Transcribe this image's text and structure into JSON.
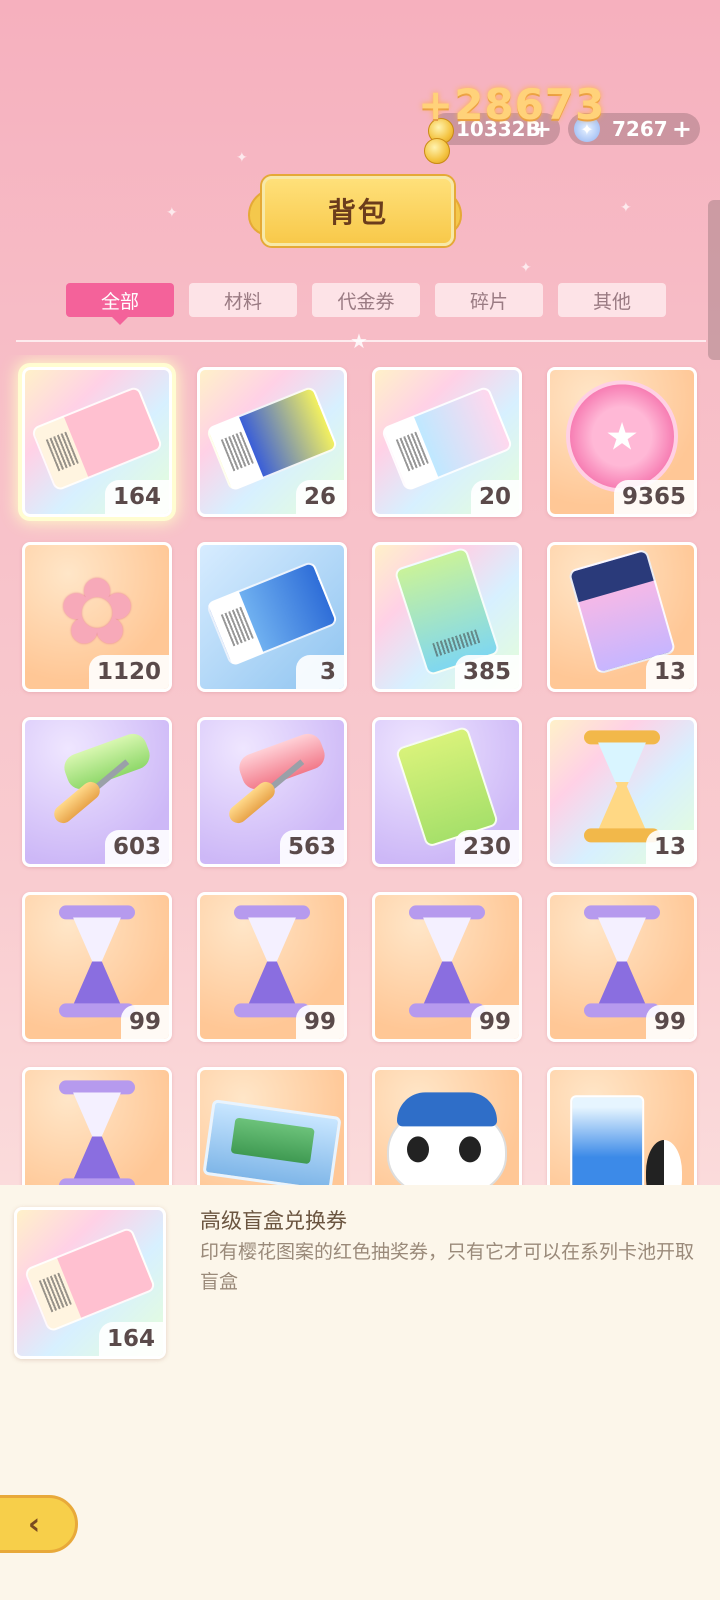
{
  "header": {
    "title": "背包",
    "gold_amount": "10332B",
    "gold_gain": "+28673",
    "gem_amount": "7267",
    "plus": "+"
  },
  "tabs": [
    {
      "label": "全部",
      "active": true
    },
    {
      "label": "材料",
      "active": false
    },
    {
      "label": "代金券",
      "active": false
    },
    {
      "label": "碎片",
      "active": false
    },
    {
      "label": "其他",
      "active": false
    }
  ],
  "items": [
    {
      "icon": "pink-sakura-ticket-icon",
      "qty": "164",
      "selected": true
    },
    {
      "icon": "mystery-ticket-icon",
      "qty": "26"
    },
    {
      "icon": "rainbow-character-ticket-icon",
      "qty": "20"
    },
    {
      "icon": "pink-bag-coin-icon",
      "qty": "9365"
    },
    {
      "icon": "sakura-flower-icon",
      "qty": "1120"
    },
    {
      "icon": "blue-ticket-icon",
      "qty": "3"
    },
    {
      "icon": "green-video-ticket-icon",
      "qty": "385"
    },
    {
      "icon": "navy-bag-ticket-icon",
      "qty": "13"
    },
    {
      "icon": "green-paint-roller-icon",
      "qty": "603"
    },
    {
      "icon": "pink-paint-roller-icon",
      "qty": "563"
    },
    {
      "icon": "lime-bag-ticket-icon",
      "qty": "230"
    },
    {
      "icon": "golden-hourglass-icon",
      "qty": "13"
    },
    {
      "icon": "purple-hourglass-icon",
      "qty": "99"
    },
    {
      "icon": "purple-hourglass-icon",
      "qty": "99"
    },
    {
      "icon": "purple-hourglass-icon",
      "qty": "99"
    },
    {
      "icon": "purple-hourglass-icon",
      "qty": "99"
    },
    {
      "icon": "purple-hourglass-icon",
      "qty": ""
    },
    {
      "icon": "bear-puzzle-box-icon",
      "qty": ""
    },
    {
      "icon": "panda-plush-icon",
      "qty": ""
    },
    {
      "icon": "penguin-drink-icon",
      "qty": ""
    }
  ],
  "detail": {
    "name": "高级盲盒兑换券",
    "description": "印有樱花图案的红色抽奖券，只有它才可以在系列卡池开取盲盒",
    "qty": "164"
  },
  "colors": {
    "accent": "#f4629a",
    "gold": "#f7cf4a",
    "panel": "#fcf6ea"
  }
}
